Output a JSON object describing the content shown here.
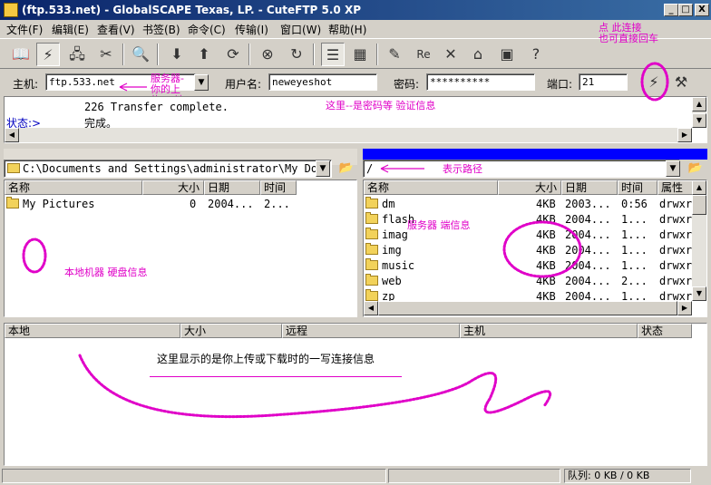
{
  "window": {
    "title": "(ftp.533.net) - GlobalSCAPE Texas, LP. - CuteFTP 5.0 XP",
    "min": "_",
    "max": "□",
    "close": "X"
  },
  "menu": [
    "文件(F)",
    "编辑(E)",
    "查看(V)",
    "书签(B)",
    "命令(C)",
    "传输(I)",
    "窗口(W)",
    "帮助(H)"
  ],
  "toolbar_icons": [
    "site-manager-icon",
    "connect-icon",
    "quick-connect-icon",
    "disconnect-icon",
    "search-icon",
    "download-icon",
    "upload-icon",
    "transfer-icon",
    "stop-icon",
    "refresh-icon",
    "log-view-icon",
    "list-view-icon",
    "edit-icon",
    "rename-icon",
    "delete-icon",
    "properties-icon",
    "new-folder-icon",
    "help-icon"
  ],
  "connection": {
    "host_label": "主机:",
    "host_value": "ftp.533.net",
    "user_label": "用户名:",
    "user_value": "neweyeshot",
    "pass_label": "密码:",
    "pass_value": "**********",
    "port_label": "端口:",
    "port_value": "21"
  },
  "log": {
    "line1": "226 Transfer complete.",
    "line2": "完成。",
    "status_label": "状态:>"
  },
  "local": {
    "path": "C:\\Documents and Settings\\administrator\\My Doc",
    "columns": [
      "名称",
      "大小",
      "日期",
      "时间"
    ],
    "files": [
      {
        "name": "My Pictures",
        "size": "0",
        "date": "2004...",
        "time": "2..."
      }
    ]
  },
  "remote": {
    "path": "/",
    "columns": [
      "名称",
      "大小",
      "日期",
      "时间",
      "属性"
    ],
    "files": [
      {
        "name": "dm",
        "size": "4KB",
        "date": "2003...",
        "time": "0:56",
        "attr": "drwxr"
      },
      {
        "name": "flash",
        "size": "4KB",
        "date": "2004...",
        "time": "1...",
        "attr": "drwxr"
      },
      {
        "name": "imag",
        "size": "4KB",
        "date": "2004...",
        "time": "1...",
        "attr": "drwxr"
      },
      {
        "name": "img",
        "size": "4KB",
        "date": "2004...",
        "time": "1...",
        "attr": "drwxr"
      },
      {
        "name": "music",
        "size": "4KB",
        "date": "2004...",
        "time": "1...",
        "attr": "drwxr"
      },
      {
        "name": "web",
        "size": "4KB",
        "date": "2004...",
        "time": "2...",
        "attr": "drwxr"
      },
      {
        "name": "zp",
        "size": "4KB",
        "date": "2004...",
        "time": "1...",
        "attr": "drwxr"
      }
    ]
  },
  "queue": {
    "columns": [
      "本地",
      "大小",
      "远程",
      "主机",
      "状态"
    ],
    "status": "队列: 0 KB / 0 KB"
  },
  "annotations": {
    "connect_hint": "点 此连接\n也可直接回车",
    "server_hint": "服务器-\n你的上\n传ftp地\n址",
    "password_hint": "这里--是密码等    验证信息",
    "path_hint": "表示路径",
    "server_info": "服务器    端信息",
    "local_info": "本地机器  硬盘信息",
    "queue_info": "这里显示的是你上传或下载时的一写连接信息"
  },
  "colors": {
    "annotation": "#e000c8",
    "titlebar": "#0a246a",
    "active_pane": "#0000ff"
  }
}
